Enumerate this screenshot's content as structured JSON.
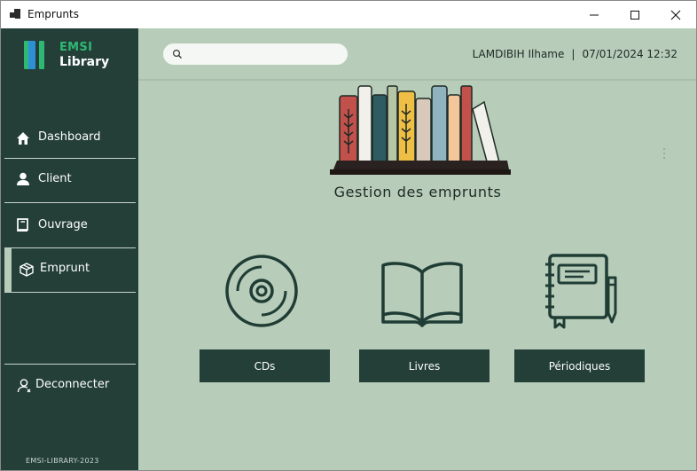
{
  "window": {
    "title": "Emprunts"
  },
  "sidebar": {
    "logo_line1": "EMSI",
    "logo_line2": "Library",
    "items": [
      {
        "label": "Dashboard",
        "icon": "home-icon"
      },
      {
        "label": "Client",
        "icon": "user-icon"
      },
      {
        "label": "Ouvrage",
        "icon": "book-icon"
      },
      {
        "label": "Emprunt",
        "icon": "box-icon",
        "active": true
      }
    ],
    "logout_label": "Deconnecter",
    "footer": "EMSI-LIBRARY-2023"
  },
  "header": {
    "search_placeholder": "",
    "search_value": "",
    "user": "LAMDIBIH Ilhame",
    "separator": "|",
    "datetime": "07/01/2024 12:32"
  },
  "main": {
    "title": "Gestion des emprunts",
    "cards": [
      {
        "label": "CDs",
        "icon": "cd-icon"
      },
      {
        "label": "Livres",
        "icon": "open-book-icon"
      },
      {
        "label": "Périodiques",
        "icon": "notebook-icon"
      }
    ]
  },
  "colors": {
    "sidebar_bg": "#233f37",
    "content_bg": "#b7ccb9",
    "accent_green": "#2fb874",
    "button_bg": "#233f37"
  }
}
